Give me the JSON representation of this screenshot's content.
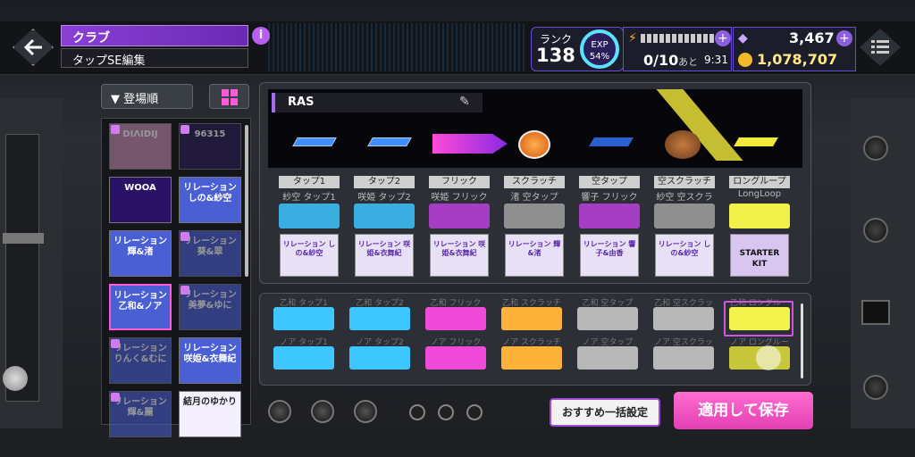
{
  "header": {
    "title": "クラブ",
    "subtitle": "タップSE編集",
    "rank_label": "ランク",
    "rank_value": "138",
    "exp_label": "EXP",
    "exp_percent": "54%",
    "stamina_count": "0/10",
    "stamina_after": "あと",
    "stamina_time": "9:31",
    "gems": "3,467",
    "coins": "1,078,707"
  },
  "sidebar": {
    "sort_label": "登場順",
    "items": [
      {
        "label": "DIΛIDIJ",
        "color": "#c58bb0",
        "locked": true
      },
      {
        "label": "96315",
        "color": "#2b1f55",
        "locked": true
      },
      {
        "label": "WOOA",
        "color": "#2a1266",
        "locked": false
      },
      {
        "label": "リレーション しの&紗空",
        "color": "#4a5fd4",
        "locked": false
      },
      {
        "label": "リレーション 輝&渚",
        "color": "#4a5fd4",
        "locked": false
      },
      {
        "label": "リレーション 葵&翠",
        "color": "#4a5fd4",
        "locked": true
      },
      {
        "label": "リレーション 乙和&ノア",
        "color": "#4a5fd4",
        "locked": false
      },
      {
        "label": "リレーション 美夢&ゆに",
        "color": "#4a5fd4",
        "locked": true
      },
      {
        "label": "リレーション りんく&むに",
        "color": "#4a5fd4",
        "locked": true
      },
      {
        "label": "リレーション 咲姫&衣舞紀",
        "color": "#4a5fd4",
        "locked": false
      },
      {
        "label": "リレーション 輝&麗",
        "color": "#4a5fd4",
        "locked": true
      },
      {
        "label": "結月のゆかり",
        "color": "#f4f0ff",
        "locked": false
      }
    ]
  },
  "preset": {
    "name": "RAS"
  },
  "columns": [
    {
      "label": "タップ1",
      "sub": "紗空 タップ1",
      "color": "#3aaee0",
      "icon": "リレーション しの&紗空"
    },
    {
      "label": "タップ2",
      "sub": "咲姫 タップ2",
      "color": "#3aaee0",
      "icon": "リレーション 咲姫&衣舞紀"
    },
    {
      "label": "フリック",
      "sub": "咲姫 フリック",
      "color": "#a63ec4",
      "icon": "リレーション 咲姫&衣舞紀"
    },
    {
      "label": "スクラッチ",
      "sub": "渚 空タップ",
      "color": "#8f8f8f",
      "icon": "リレーション 輝&渚"
    },
    {
      "label": "空タップ",
      "sub": "響子 フリック",
      "color": "#a63ec4",
      "icon": "リレーション 響子&由香"
    },
    {
      "label": "空スクラッチ",
      "sub": "紗空 空スクラッチ",
      "color": "#8f8f8f",
      "icon": "リレーション しの&紗空"
    },
    {
      "label": "ロングループ",
      "sub": "LongLoop",
      "color": "#f1f04a",
      "icon": "STARTER KIT"
    }
  ],
  "pads": {
    "row1": [
      {
        "label": "乙和 タップ1",
        "color": "#3ec7ff"
      },
      {
        "label": "乙和 タップ2",
        "color": "#3ec7ff"
      },
      {
        "label": "乙和 フリック",
        "color": "#f04ad8"
      },
      {
        "label": "乙和 スクラッチ",
        "color": "#ffb23a"
      },
      {
        "label": "乙和 空タップ",
        "color": "#b8b8b8"
      },
      {
        "label": "乙和 空スクラッチ",
        "color": "#b8b8b8"
      },
      {
        "label": "乙和 ロングループ",
        "color": "#f3f24c"
      }
    ],
    "row2": [
      {
        "label": "ノア タップ1",
        "color": "#3ec7ff"
      },
      {
        "label": "ノア タップ2",
        "color": "#3ec7ff"
      },
      {
        "label": "ノア フリック",
        "color": "#f04ad8"
      },
      {
        "label": "ノア スクラッチ",
        "color": "#ffb23a"
      },
      {
        "label": "ノア 空タップ",
        "color": "#b8b8b8"
      },
      {
        "label": "ノア 空スクラッチ",
        "color": "#b8b8b8"
      },
      {
        "label": "ノア ロングループ",
        "color": "#c8c73c"
      }
    ]
  },
  "buttons": {
    "recommend": "おすすめ一括設定",
    "save": "適用して保存"
  }
}
